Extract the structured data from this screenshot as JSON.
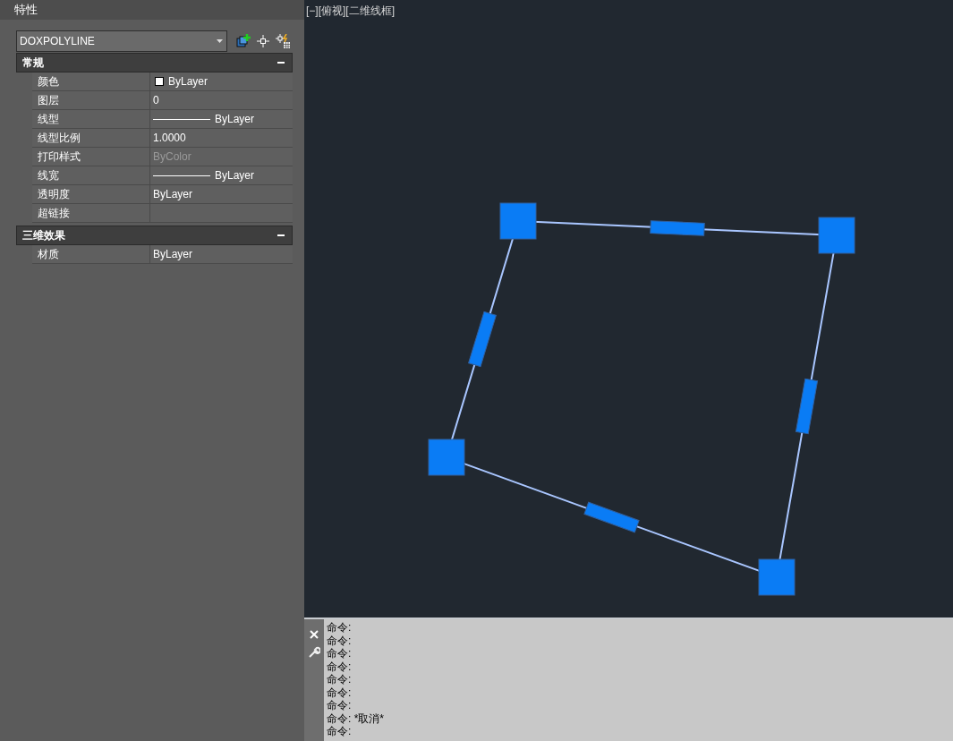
{
  "panel": {
    "title": "特性",
    "object_type": "DOXPOLYLINE"
  },
  "sections": [
    {
      "title": "常规",
      "expanded": true,
      "rows": [
        {
          "label": "颜色",
          "value": "ByLayer",
          "kind": "color",
          "disabled": false
        },
        {
          "label": "图层",
          "value": "0",
          "kind": "text",
          "disabled": false
        },
        {
          "label": "线型",
          "value": "ByLayer",
          "kind": "line",
          "disabled": false
        },
        {
          "label": "线型比例",
          "value": "1.0000",
          "kind": "text",
          "disabled": false
        },
        {
          "label": "打印样式",
          "value": "ByColor",
          "kind": "text",
          "disabled": true
        },
        {
          "label": "线宽",
          "value": "ByLayer",
          "kind": "line",
          "disabled": false
        },
        {
          "label": "透明度",
          "value": "ByLayer",
          "kind": "text",
          "disabled": false
        },
        {
          "label": "超链接",
          "kind": "text",
          "disabled": false
        }
      ]
    },
    {
      "title": "三维效果",
      "expanded": true,
      "rows": [
        {
          "label": "材质",
          "value": "ByLayer",
          "kind": "text",
          "disabled": false
        }
      ]
    }
  ],
  "viewport": {
    "label": "[−][俯视][二维线框]"
  },
  "command_lines": [
    "命令:",
    "命令:",
    "命令:",
    "命令:",
    "命令:",
    "命令:",
    "命令:",
    "命令: *取消*",
    "命令:"
  ]
}
